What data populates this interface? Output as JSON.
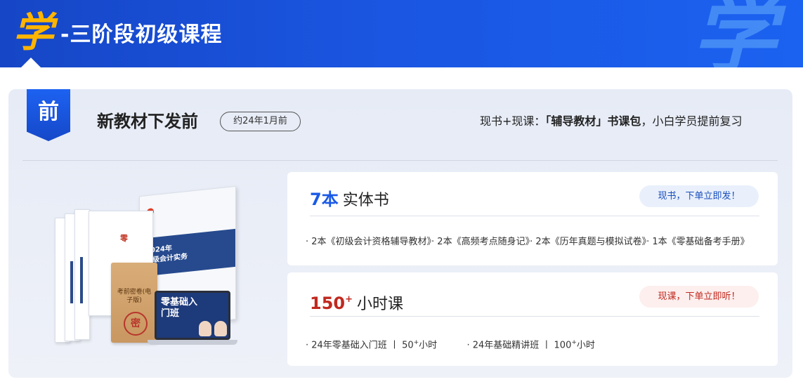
{
  "header": {
    "icon_char": "学",
    "title": "-三阶段初级课程",
    "watermark_char": "学",
    "background_color": "#1a55e0",
    "accent_color": "#ffb400"
  },
  "stage": {
    "badge": "前",
    "title": "新教材下发前",
    "pill": "约24年1月前",
    "desc_prefix": "现书+现课：",
    "desc_bold": "「辅导教材」书课包",
    "desc_suffix": "，小白学员提前复习"
  },
  "illustration": {
    "book_big_year": "2024年",
    "book_big_title": "初级会计实务",
    "book_mid_label": "零",
    "envelope_title": "考前密卷(电子版)",
    "envelope_stamp": "密",
    "laptop_title": "零基础入门班"
  },
  "card_books": {
    "count": "7本",
    "label": "实体书",
    "tag": "现书，下单立即发！",
    "items": "· 2本《初级会计资格辅导教材》· 2本《高频考点随身记》· 2本《历年真题与模拟试卷》· 1本《零基础备考手册》"
  },
  "card_courses": {
    "count": "150",
    "count_sup": "+",
    "label": "小时课",
    "tag": "现课，下单立即听！",
    "item1": "· 24年零基础入门班 丨 50",
    "item1_sup": "+",
    "item1_unit": "小时",
    "item2": "· 24年基础精讲班 丨 100",
    "item2_sup": "+",
    "item2_unit": "小时"
  }
}
